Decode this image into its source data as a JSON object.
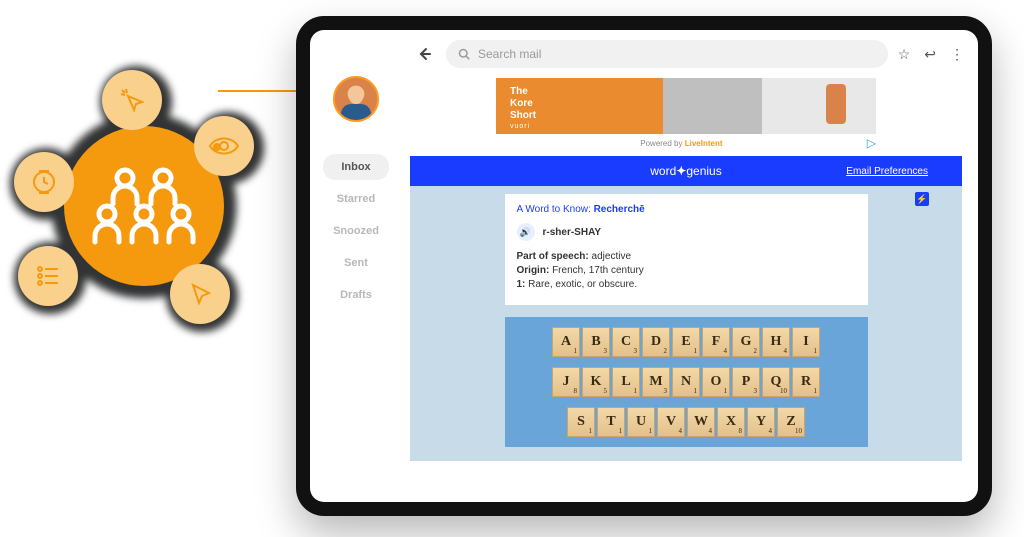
{
  "search": {
    "placeholder": "Search mail"
  },
  "nav": {
    "items": [
      {
        "label": "Inbox"
      },
      {
        "label": "Starred"
      },
      {
        "label": "Snoozed"
      },
      {
        "label": "Sent"
      },
      {
        "label": "Drafts"
      }
    ]
  },
  "ad": {
    "line1": "The",
    "line2": "Kore",
    "line3": "Short",
    "brand": "vuori",
    "powered_prefix": "Powered by ",
    "powered_brand": "LiveIntent"
  },
  "bluebar": {
    "brand_left": "word",
    "brand_right": "genius",
    "prefs": "Email Preferences"
  },
  "word_card": {
    "title_label": "A Word to Know: ",
    "title_word": "Recherchē",
    "pronunciation": "r-sher-SHAY",
    "pos_label": "Part of speech: ",
    "pos_value": "adjective",
    "origin_label": "Origin: ",
    "origin_value": "French, 17th century",
    "def_label": "1: ",
    "def_value": "Rare, exotic, or obscure."
  },
  "tiles": {
    "row1": [
      {
        "l": "A",
        "p": "1"
      },
      {
        "l": "B",
        "p": "3"
      },
      {
        "l": "C",
        "p": "3"
      },
      {
        "l": "D",
        "p": "2"
      },
      {
        "l": "E",
        "p": "1"
      },
      {
        "l": "F",
        "p": "4"
      },
      {
        "l": "G",
        "p": "2"
      },
      {
        "l": "H",
        "p": "4"
      },
      {
        "l": "I",
        "p": "1"
      }
    ],
    "row2": [
      {
        "l": "J",
        "p": "8"
      },
      {
        "l": "K",
        "p": "5"
      },
      {
        "l": "L",
        "p": "1"
      },
      {
        "l": "M",
        "p": "3"
      },
      {
        "l": "N",
        "p": "1"
      },
      {
        "l": "O",
        "p": "1"
      },
      {
        "l": "P",
        "p": "3"
      },
      {
        "l": "Q",
        "p": "10"
      },
      {
        "l": "R",
        "p": "1"
      }
    ],
    "row3": [
      {
        "l": "S",
        "p": "1"
      },
      {
        "l": "T",
        "p": "1"
      },
      {
        "l": "U",
        "p": "1"
      },
      {
        "l": "V",
        "p": "4"
      },
      {
        "l": "W",
        "p": "4"
      },
      {
        "l": "X",
        "p": "8"
      },
      {
        "l": "Y",
        "p": "4"
      },
      {
        "l": "Z",
        "p": "10"
      }
    ]
  }
}
